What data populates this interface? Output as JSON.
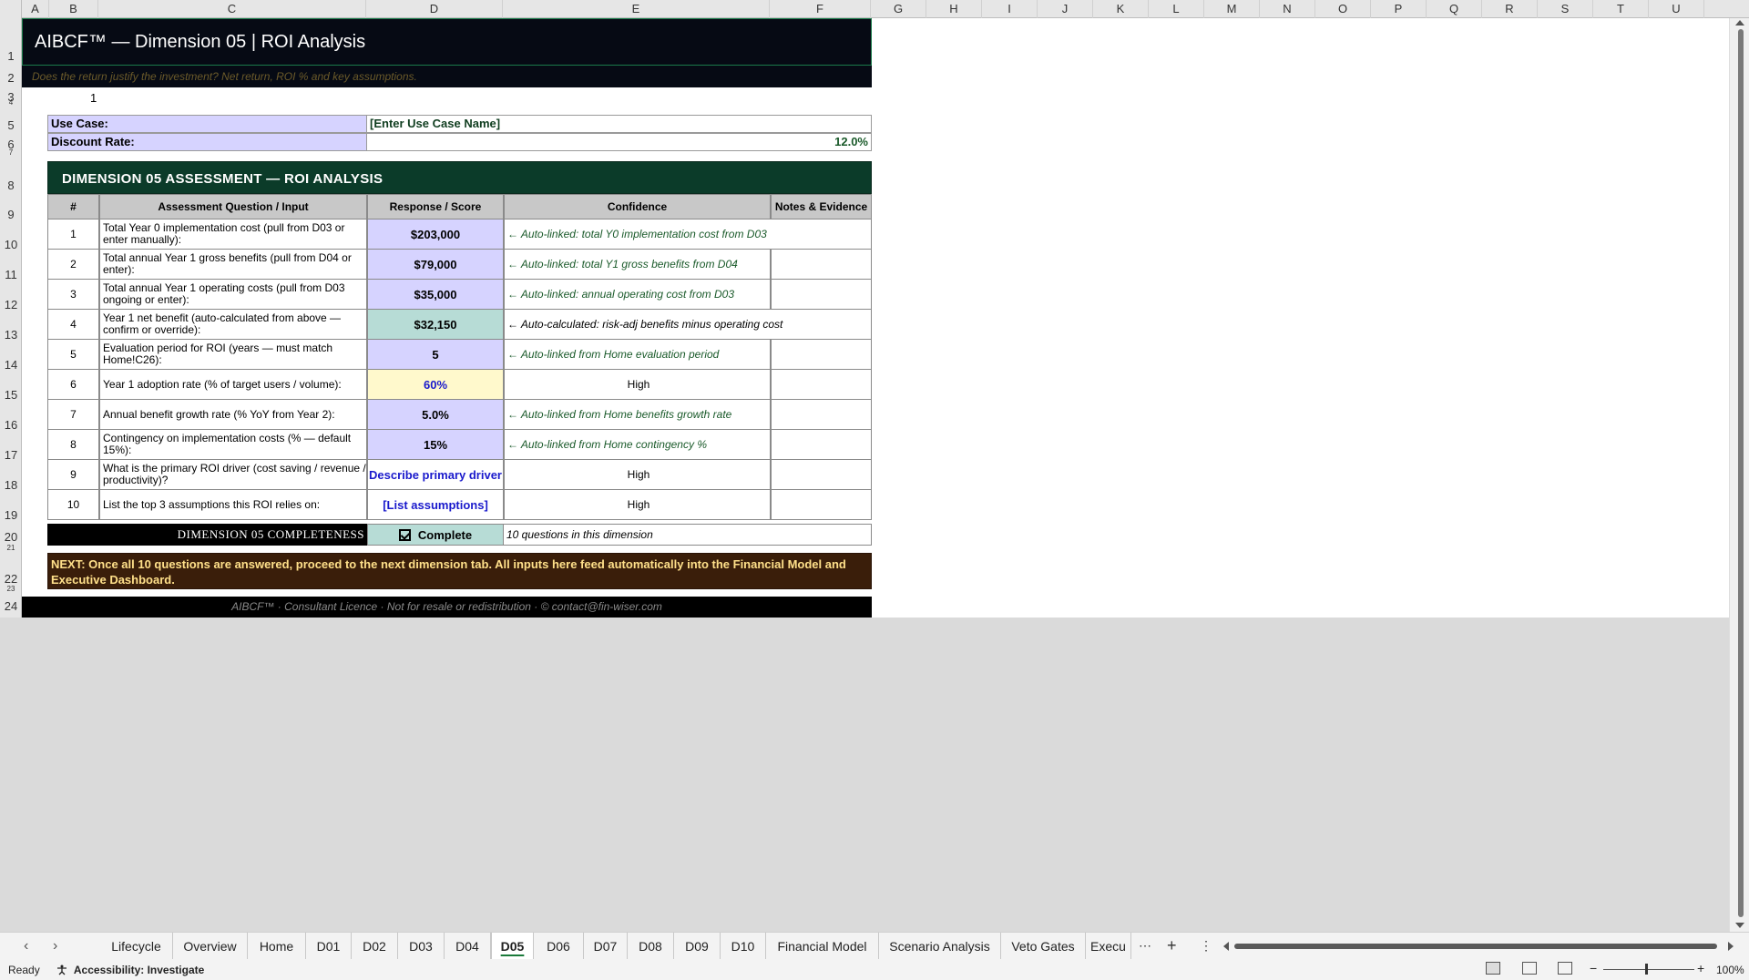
{
  "columns": [
    "A",
    "B",
    "C",
    "D",
    "E",
    "F",
    "G",
    "H",
    "I",
    "J",
    "K",
    "L",
    "M",
    "N",
    "O",
    "P",
    "Q",
    "R",
    "S",
    "T",
    "U"
  ],
  "rows": [
    "1",
    "2",
    "3",
    "4",
    "5",
    "6",
    "7",
    "8",
    "9",
    "10",
    "11",
    "12",
    "13",
    "14",
    "15",
    "16",
    "17",
    "18",
    "19",
    "20",
    "21",
    "22",
    "23",
    "24"
  ],
  "sheet": {
    "title": "AIBCF™  —  Dimension 05  |  ROI Analysis",
    "subtitle": "Does the return justify the investment? Net return, ROI % and key assumptions.",
    "row3_value": "1",
    "use_case_label": "Use Case:",
    "use_case_value": "[Enter Use Case Name]",
    "discount_rate_label": "Discount Rate:",
    "discount_rate_value": "12.0%",
    "section_title": "DIMENSION 05 ASSESSMENT  —  ROI ANALYSIS",
    "headers": {
      "num": "#",
      "question": "Assessment Question / Input",
      "response": "Response / Score",
      "confidence": "Confidence",
      "notes": "Notes & Evidence"
    },
    "items": [
      {
        "num": "1",
        "question": "Total Year 0 implementation cost (pull from D03 or enter manually):",
        "response": "$203,000",
        "confidence": "← Auto-linked: total Y0 implementation cost from D03"
      },
      {
        "num": "2",
        "question": "Total annual Year 1 gross benefits (pull from D04 or enter):",
        "response": "$79,000",
        "confidence": "← Auto-linked: total Y1 gross benefits from D04"
      },
      {
        "num": "3",
        "question": "Total annual Year 1 operating costs (pull from D03 ongoing or enter):",
        "response": "$35,000",
        "confidence": "← Auto-linked: annual operating cost from D03"
      },
      {
        "num": "4",
        "question": "Year 1 net benefit (auto-calculated from above — confirm or override):",
        "response": "$32,150",
        "confidence": "← Auto-calculated: risk-adj benefits minus operating cost"
      },
      {
        "num": "5",
        "question": "Evaluation period for ROI (years — must match Home!C26):",
        "response": "5",
        "confidence": "← Auto-linked from Home evaluation period"
      },
      {
        "num": "6",
        "question": "Year 1 adoption rate (% of target users / volume):",
        "response": "60%",
        "confidence": "High"
      },
      {
        "num": "7",
        "question": "Annual benefit growth rate (% YoY from Year 2):",
        "response": "5.0%",
        "confidence": "← Auto-linked from Home benefits growth rate"
      },
      {
        "num": "8",
        "question": "Contingency on implementation costs (% — default 15%):",
        "response": "15%",
        "confidence": "← Auto-linked from Home contingency %"
      },
      {
        "num": "9",
        "question": "What is the primary ROI driver (cost saving / revenue / productivity)?",
        "response": "Describe primary driver",
        "confidence": "High"
      },
      {
        "num": "10",
        "question": "List the top 3 assumptions this ROI relies on:",
        "response": "[List assumptions]",
        "confidence": "High"
      }
    ],
    "completeness_label": "DIMENSION 05 COMPLETENESS",
    "completeness_value": "Complete",
    "completeness_note": "10 questions in this dimension",
    "next_text": "NEXT:  Once all 10 questions are answered, proceed to the next dimension tab. All inputs here feed automatically into the Financial Model and Executive Dashboard.",
    "footer": "AIBCF™  ·  Consultant Licence  ·  Not for resale or redistribution  ·  © contact@fin-wiser.com"
  },
  "tabs": [
    "Lifecycle",
    "Overview",
    "Home",
    "D01",
    "D02",
    "D03",
    "D04",
    "D05",
    "D06",
    "D07",
    "D08",
    "D09",
    "D10",
    "Financial Model",
    "Scenario Analysis",
    "Veto Gates",
    "Execu"
  ],
  "active_tab": "D05",
  "status": {
    "ready": "Ready",
    "accessibility": "Accessibility: Investigate",
    "zoom": "100%"
  }
}
